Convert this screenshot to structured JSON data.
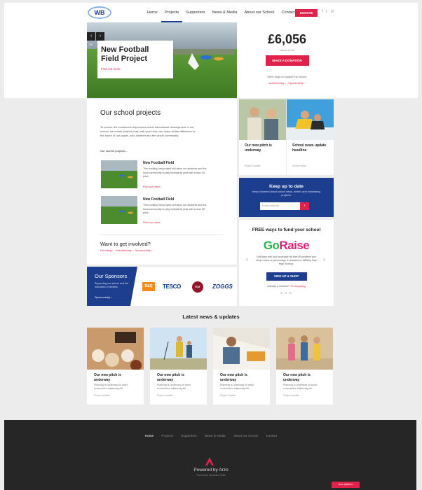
{
  "header": {
    "logo_text": "WB",
    "nav": [
      "Home",
      "Projects",
      "Supporters",
      "News & Media",
      "About our School",
      "Contact"
    ],
    "active_nav": "Projects",
    "donate": "DONATE",
    "social_icons": [
      "facebook-icon",
      "twitter-icon",
      "linkedin-icon"
    ],
    "social": [
      "f",
      "t",
      "in"
    ]
  },
  "hero": {
    "slide_counter": "1/3",
    "title_line1": "New Football",
    "title_line2": "Field Project",
    "link": "Find out more",
    "prev": "‹",
    "next": "›"
  },
  "stats": {
    "amount": "£6,056",
    "raised_label": "raised so far",
    "donate_button": "MAKE A DONATION",
    "other_ways": "Other ways to support the school:",
    "volunteering": "Volunteering",
    "sponsorship": "Sponsorship"
  },
  "projects": {
    "title": "Our school projects",
    "intro": "To ensure the continuous improvement and educational development of our school, we create projects that, with your help, can make all the difference to the future of our pupils, your children and the whole community.",
    "current_label": "Our current projects...",
    "items": [
      {
        "title": "New Football Field",
        "desc": "This exciting new project will allow our students and the local community to play football all year with a new 3G pitch.",
        "link": "Find out more"
      },
      {
        "title": "New Football Field",
        "desc": "This exciting new project will allow our students and the local community to play football all year with a new 3G pitch.",
        "link": "Find out more"
      }
    ],
    "involved_title": "Want to get involved?",
    "involved_links": [
      "Donating",
      "Volunteering",
      "Sponsorship"
    ]
  },
  "news_cards": [
    {
      "title": "Our new pitch is underway",
      "meta": "Project Update"
    },
    {
      "title": "School news update headline",
      "meta": "School News"
    }
  ],
  "newsletter": {
    "title": "Keep up to date",
    "desc": "Keep informed about school news, events and fundraising projects.",
    "placeholder": "Email Address",
    "submit": "›"
  },
  "goraise": {
    "title": "FREE ways to fund your school",
    "logo_go": "Go",
    "logo_raise": "Raise",
    "desc": "GoRaise lets you fundraise for free! Everytime you shop online a percentage is donated to Whitley Bay High School.",
    "button": "SIGN UP & SHOP",
    "member": "Already a member?",
    "member_link": "Go shopping",
    "dots": "● ● ●",
    "prev": "‹",
    "next": "›"
  },
  "sponsors": {
    "title": "Our Sponsors",
    "desc": "Supporting our school and the education of children",
    "link": "Sponsorship",
    "logos": [
      "B&Q",
      "TESCO",
      "FIAT",
      "ZOGGS"
    ]
  },
  "latest": {
    "title": "Latest news & updates",
    "items": [
      {
        "title": "Our new pitch is underway",
        "desc": "Planning is underway sit amet, consectetur adipiscing elit.",
        "meta": "Project Update"
      },
      {
        "title": "Our new pitch is underway",
        "desc": "Planning is underway sit amet, consectetur adipiscing elit.",
        "meta": "Project Update"
      },
      {
        "title": "Our new pitch is underway",
        "desc": "Planning is underway sit amet, consectetur adipiscing elit.",
        "meta": "Project Update"
      },
      {
        "title": "Our new pitch is underway",
        "desc": "Planning is underway sit amet, consectetur adipiscing elit.",
        "meta": "Project Update"
      }
    ]
  },
  "footer": {
    "nav": [
      "Home",
      "Projects",
      "Supporters",
      "News & Media",
      "About our School",
      "Contact"
    ],
    "powered": "Powered by Arzo",
    "tagline": "The Income Generation Suite",
    "platform": "Arzo platform"
  },
  "colors": {
    "primary_blue": "#1d3e8f",
    "accent_red": "#e0224b",
    "footer_bg": "#262626"
  }
}
